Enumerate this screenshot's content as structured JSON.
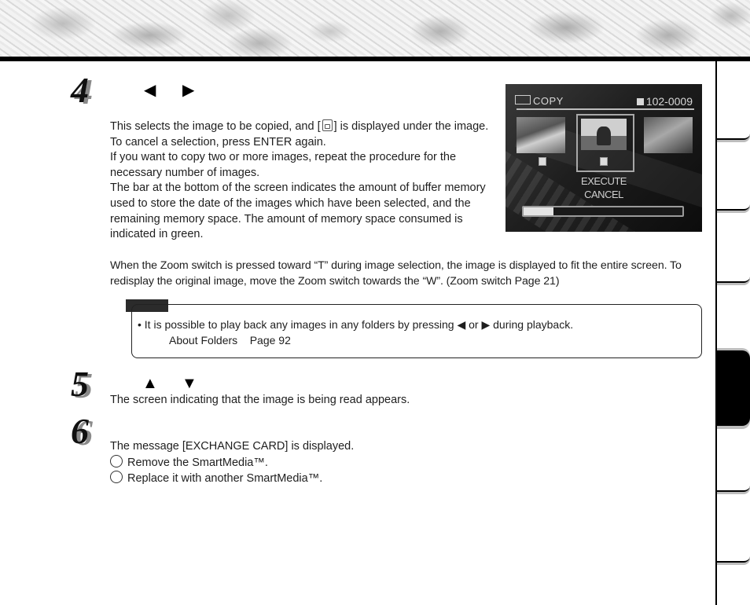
{
  "header": {
    "banner": "marble-texture-banner"
  },
  "steps": [
    {
      "number": "4",
      "keys": [
        "◀",
        "▶"
      ],
      "key_icons": [
        "left-arrow-icon",
        "right-arrow-icon"
      ],
      "paragraphs": [
        "This selects the image to be copied, and [",
        "] is displayed under the image.",
        "To cancel a selection, press ENTER again.",
        "If you want to copy two or more images, repeat the procedure for the necessary number of images.",
        "The bar at the bottom of the screen indicates the amount of buffer memory used to store the date of the images which have been selected, and the remaining memory space. The amount of memory space consumed is indicated in green.",
        "When the Zoom switch is pressed toward “T” during image selection, the image is displayed to fit the entire screen. To redisplay the original image, move the Zoom switch towards the “W”. (Zoom switch    Page 21)"
      ]
    },
    {
      "number": "5",
      "keys": [
        "▲",
        "▼"
      ],
      "key_icons": [
        "up-arrow-icon",
        "down-arrow-icon"
      ],
      "paragraphs": [
        "The screen indicating that the image is being read appears."
      ]
    },
    {
      "number": "6",
      "paragraphs": [
        "The message [EXCHANGE CARD] is displayed."
      ],
      "substeps": [
        "Remove the SmartMedia™.",
        "Replace it with another SmartMedia™."
      ]
    }
  ],
  "camera_screen": {
    "mode": "COPY",
    "file_number": "102-0009",
    "menu": [
      "EXECUTE",
      "CANCEL"
    ],
    "buffer_used_percent": 19
  },
  "note": {
    "bullet": "•",
    "text_before": "It is possible to play back any images in any folders by pressing",
    "left_key": "◀",
    "or": "or",
    "right_key": "▶",
    "text_after": "during playback.",
    "reference": "About Folders    Page 92"
  },
  "side_tabs": {
    "count": 7,
    "active_index": 4
  }
}
